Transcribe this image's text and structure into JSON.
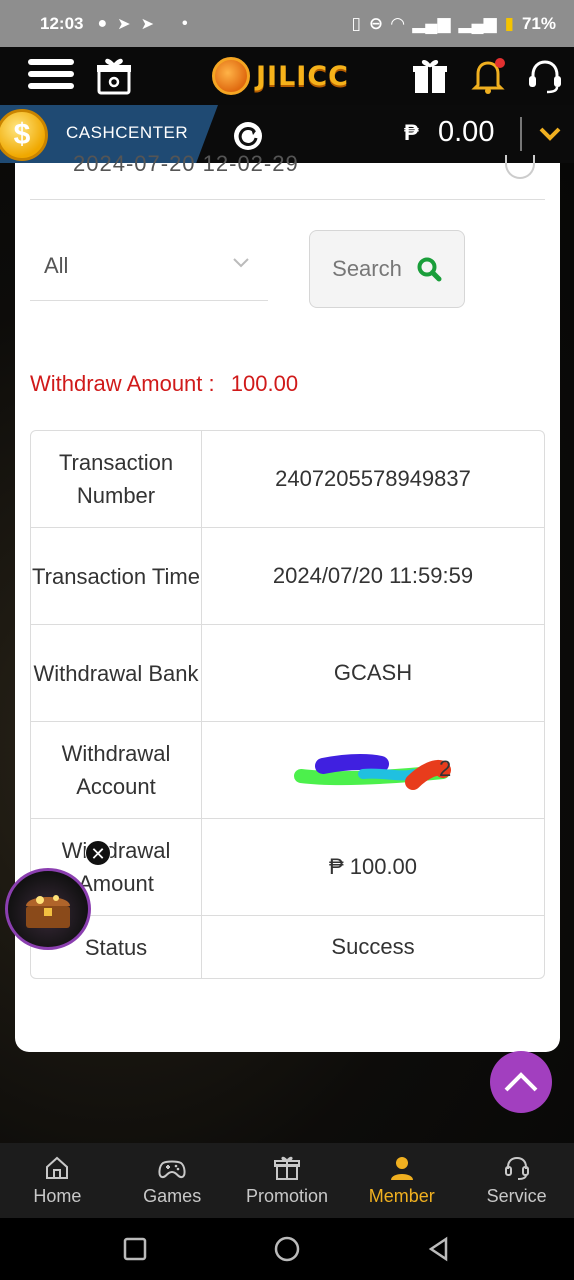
{
  "status_bar": {
    "time": "12:03",
    "battery": "71%"
  },
  "header": {
    "logo_text": "JILICC"
  },
  "cash_center": {
    "label": "CASHCENTER",
    "currency": "₱",
    "balance": "0.00"
  },
  "record": {
    "date_partial": "2024-07-20 12-02-29",
    "filter": {
      "selected": "All"
    },
    "search_label": "Search",
    "withdraw_amount_label": "Withdraw Amount :",
    "withdraw_amount_value": "100.00",
    "rows": [
      {
        "label": "Transaction Number",
        "value": "2407205578949837"
      },
      {
        "label": "Transaction Time",
        "value": "2024/07/20 11:59:59"
      },
      {
        "label": "Withdrawal Bank",
        "value": "GCASH"
      },
      {
        "label": "Withdrawal Account",
        "value": "2"
      },
      {
        "label": "Withdrawal Amount",
        "value": "₱ 100.00"
      },
      {
        "label": "Status",
        "value": "Success"
      }
    ]
  },
  "bottom_nav": [
    {
      "label": "Home",
      "icon": "home-icon"
    },
    {
      "label": "Games",
      "icon": "gamepad-icon"
    },
    {
      "label": "Promotion",
      "icon": "gift-icon"
    },
    {
      "label": "Member",
      "icon": "member-icon",
      "active": true
    },
    {
      "label": "Service",
      "icon": "headset-icon"
    }
  ],
  "colors": {
    "accent": "#f0b020",
    "alert": "#d01a1a",
    "fab": "#a23fbf"
  }
}
